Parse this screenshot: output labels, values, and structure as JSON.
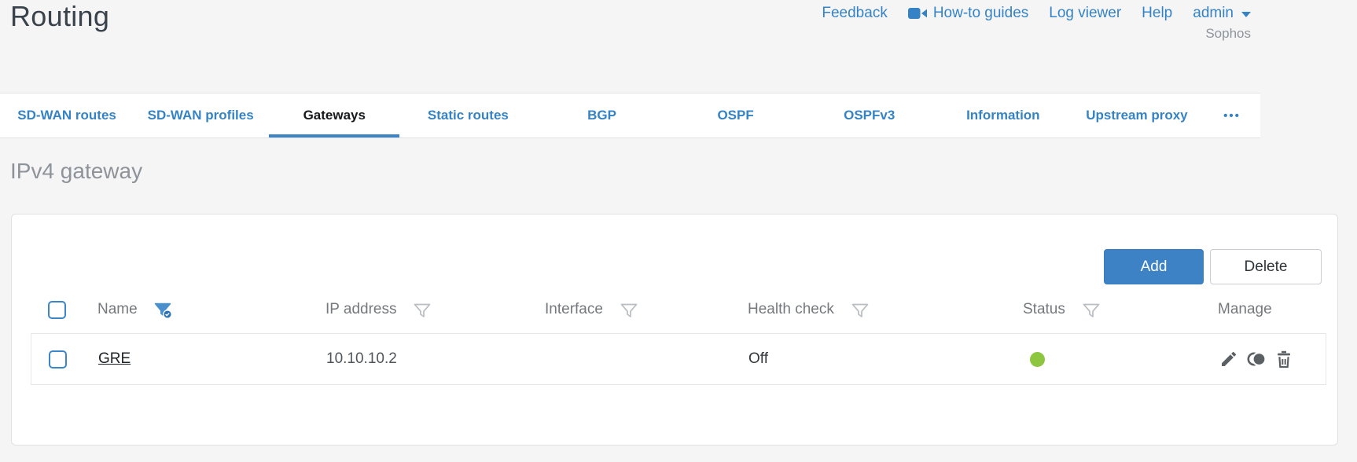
{
  "header": {
    "title": "Routing",
    "links": [
      {
        "label": "Feedback"
      },
      {
        "label": "How-to guides",
        "icon": "video-camera-icon"
      },
      {
        "label": "Log viewer"
      },
      {
        "label": "Help"
      }
    ],
    "user_menu": {
      "label": "admin",
      "icon": "chevron-down-icon"
    },
    "brand": "Sophos"
  },
  "tabs": {
    "items": [
      {
        "label": "SD-WAN routes",
        "active": false
      },
      {
        "label": "SD-WAN profiles",
        "active": false
      },
      {
        "label": "Gateways",
        "active": true
      },
      {
        "label": "Static routes",
        "active": false
      },
      {
        "label": "BGP",
        "active": false
      },
      {
        "label": "OSPF",
        "active": false
      },
      {
        "label": "OSPFv3",
        "active": false
      },
      {
        "label": "Information",
        "active": false
      },
      {
        "label": "Upstream proxy",
        "active": false
      }
    ],
    "more_label": "•••"
  },
  "section": {
    "title": "IPv4 gateway"
  },
  "toolbar": {
    "add_label": "Add",
    "delete_label": "Delete"
  },
  "table": {
    "columns": [
      {
        "label": "Name",
        "filter": "active"
      },
      {
        "label": "IP address",
        "filter": "inactive"
      },
      {
        "label": "Interface",
        "filter": "inactive"
      },
      {
        "label": "Health check",
        "filter": "inactive"
      },
      {
        "label": "Status",
        "filter": "inactive"
      },
      {
        "label": "Manage",
        "filter": "none"
      }
    ],
    "rows": [
      {
        "name": "GRE",
        "ip_address": "10.10.10.2",
        "interface": "",
        "health_check": "Off",
        "status": "up",
        "manage_icons": [
          "edit",
          "clone",
          "delete"
        ]
      }
    ]
  },
  "colors": {
    "accent_blue": "#3583c4",
    "add_button_blue": "#3d82c4",
    "active_tab_underline": "#3d84c6",
    "status_up_green": "#8dc63f",
    "checkbox_border_blue": "#3a86c8"
  }
}
